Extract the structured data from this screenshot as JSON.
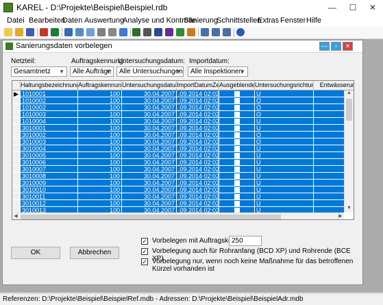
{
  "window": {
    "title": "KAREL - D:\\Projekte\\Beispiel\\Beispiel.rdb",
    "minimize": "—",
    "maximize": "☐",
    "close": "✕"
  },
  "menu": [
    "Datei",
    "Bearbeiten",
    "Daten",
    "Auswertung",
    "Analyse und Kontrolle",
    "Sanierung",
    "Schnittstellen",
    "Extras",
    "Fenster",
    "Hilfe"
  ],
  "dialog": {
    "title": "Sanierungsdaten vorbelegen",
    "filters": {
      "netzteil_label": "Netzteil:",
      "netzteil_value": "Gesamtnetz",
      "auftrag_label": "Auftragskennung:",
      "auftrag_value": "Alle Aufträge",
      "datum_label": "Untersuchungsdatum:",
      "datum_value": "Alle Untersuchungen",
      "import_label": "Importdatum:",
      "import_value": "Alle Inspektionen"
    },
    "columns": [
      "Haltungsbezeichnung",
      "Auftragskennung",
      "Untersuchungsdatum",
      "ImportDatumZeit",
      "Ausgeblendet",
      "Untersuchungsrichtung",
      "Entwässerungs"
    ],
    "rows": [
      [
        "1010001",
        "100",
        "30.04.2007",
        ".09.2014 02:02:30",
        "U"
      ],
      [
        "1010002",
        "100",
        "30.04.2007",
        ".09.2014 02:02:30",
        "O"
      ],
      [
        "1010002",
        "100",
        "30.04.2007",
        ".09.2014 02:02:30",
        "O"
      ],
      [
        "1010003",
        "100",
        "30.04.2007",
        ".09.2014 02:02:30",
        "O"
      ],
      [
        "1010004",
        "100",
        "30.04.2007",
        ".09.2014 02:02:30",
        "U"
      ],
      [
        "3010001",
        "100",
        "30.04.2007",
        ".09.2014 02:02:30",
        "U"
      ],
      [
        "3010002",
        "100",
        "30.04.2007",
        ".09.2014 02:02:30",
        "O"
      ],
      [
        "3010003",
        "100",
        "30.04.2007",
        ".09.2014 02:02:30",
        "O"
      ],
      [
        "3010004",
        "100",
        "30.04.2007",
        ".09.2014 02:02:30",
        "U"
      ],
      [
        "3010005",
        "100",
        "30.04.2007",
        ".09.2014 02:02:30",
        "U"
      ],
      [
        "3010006",
        "100",
        "30.04.2007",
        ".09.2014 02:02:30",
        "U"
      ],
      [
        "3010007",
        "100",
        "30.04.2007",
        ".09.2014 02:02:30",
        "U"
      ],
      [
        "3010008",
        "100",
        "30.04.2007",
        ".09.2014 02:02:30",
        "U"
      ],
      [
        "3010009",
        "100",
        "30.04.2007",
        ".09.2014 02:02:30",
        "U"
      ],
      [
        "3010010",
        "100",
        "30.04.2007",
        ".09.2014 02:02:30",
        "U"
      ],
      [
        "3010011",
        "100",
        "30.04.2007",
        ".09.2014 02:02:30",
        "U"
      ],
      [
        "3010012",
        "100",
        "30.04.2007",
        ".09.2014 02:02:30",
        "U"
      ],
      [
        "3010013",
        "100",
        "30.04.2007",
        ".09.2014 02:02:30",
        "U"
      ]
    ],
    "options": {
      "vorbelegen_label": "Vorbelegen mit Auftragskennung:",
      "vorbelegen_value": "250",
      "rohranfang_label": "Vorbelegung auch für Rohranfang (BCD XP) und Rohrende (BCE XP)",
      "nur_wenn_label": "Vorbelegung nur, wenn noch keine Maßnahme für das betroffenen Kürzel vorhanden ist"
    },
    "ok_label": "OK",
    "cancel_label": "Abbrechen"
  },
  "status": "Referenzen: D:\\Projekte\\Beispiel\\BeispielRef.mdb - Adressen: D:\\Projekte\\Beispiel\\BeispielAdr.mdb",
  "colors": {
    "selection": "#0078d7",
    "app_icon": "#4a7f2a",
    "mdi_background": "#ababab"
  }
}
